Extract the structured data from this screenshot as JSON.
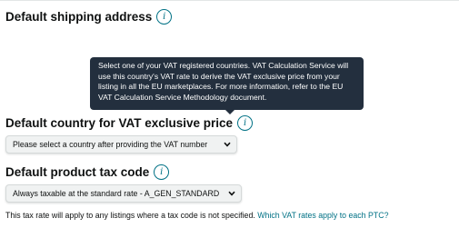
{
  "shipping": {
    "title": "Default shipping address",
    "info_icon": "info-icon"
  },
  "tooltip": {
    "text": "Select one of your VAT registered countries. VAT Calculation Service will use this country's VAT rate to derive the VAT exclusive price from your listing in all the EU marketplaces. For more information, refer to the EU VAT Calculation Service Methodology document."
  },
  "vat_country": {
    "title": "Default country for VAT exclusive price",
    "info_icon": "info-icon",
    "selected": "Please select a country after providing the VAT number",
    "chevron_icon": "chevron-down-icon"
  },
  "tax_code": {
    "title": "Default product tax code",
    "info_icon": "info-icon",
    "selected": "Always taxable at the standard rate - A_GEN_STANDARD",
    "chevron_icon": "chevron-down-icon"
  },
  "footnote": {
    "text": "This tax rate will apply to any listings where a tax code is not specified.",
    "link": "Which VAT rates apply to each PTC?"
  },
  "colors": {
    "link": "#007185",
    "tooltip_bg": "#232f3e",
    "select_bg": "#f0f2f2",
    "text": "#0f1111"
  }
}
